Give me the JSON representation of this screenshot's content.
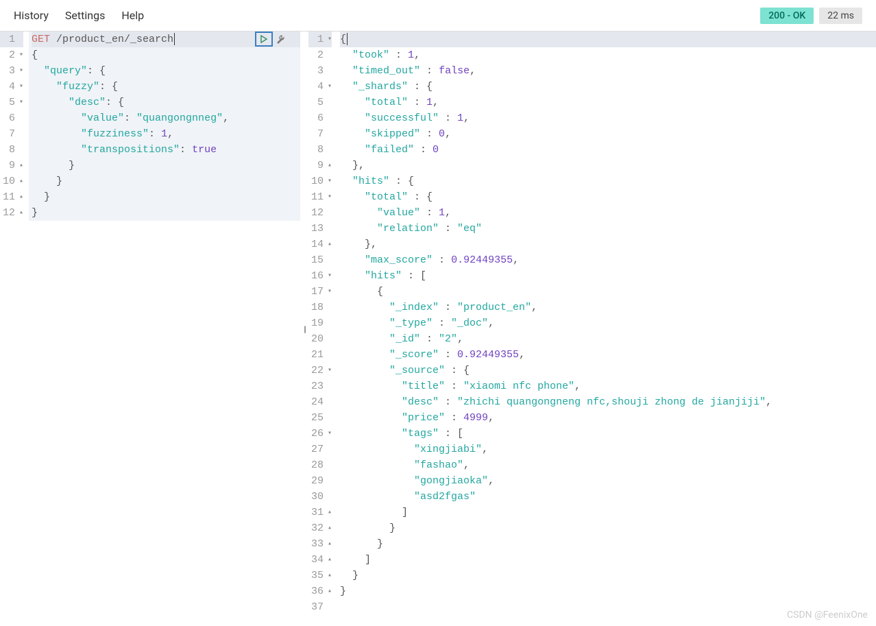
{
  "menubar": {
    "history": "History",
    "settings": "Settings",
    "help": "Help"
  },
  "status": {
    "badge": "200 - OK",
    "timing": "22 ms"
  },
  "splitter_glyph": "||",
  "watermark": "CSDN @FeenixOne",
  "request": {
    "lines": [
      {
        "n": 1,
        "fold": "",
        "tokens": [
          [
            "method",
            "GET"
          ],
          [
            "text",
            " /product_en/_search"
          ]
        ]
      },
      {
        "n": 2,
        "fold": "▾",
        "tokens": [
          [
            "punct",
            "{"
          ]
        ]
      },
      {
        "n": 3,
        "fold": "▾",
        "tokens": [
          [
            "text",
            "  "
          ],
          [
            "key",
            "\"query\""
          ],
          [
            "punct",
            ": {"
          ]
        ]
      },
      {
        "n": 4,
        "fold": "▾",
        "tokens": [
          [
            "text",
            "    "
          ],
          [
            "key",
            "\"fuzzy\""
          ],
          [
            "punct",
            ": {"
          ]
        ]
      },
      {
        "n": 5,
        "fold": "▾",
        "tokens": [
          [
            "text",
            "      "
          ],
          [
            "key",
            "\"desc\""
          ],
          [
            "punct",
            ": {"
          ]
        ]
      },
      {
        "n": 6,
        "fold": "",
        "tokens": [
          [
            "text",
            "        "
          ],
          [
            "key",
            "\"value\""
          ],
          [
            "punct",
            ": "
          ],
          [
            "str",
            "\"quangongnneg\""
          ],
          [
            "punct",
            ","
          ]
        ]
      },
      {
        "n": 7,
        "fold": "",
        "tokens": [
          [
            "text",
            "        "
          ],
          [
            "key",
            "\"fuzziness\""
          ],
          [
            "punct",
            ": "
          ],
          [
            "num",
            "1"
          ],
          [
            "punct",
            ","
          ]
        ]
      },
      {
        "n": 8,
        "fold": "",
        "tokens": [
          [
            "text",
            "        "
          ],
          [
            "key",
            "\"transpositions\""
          ],
          [
            "punct",
            ": "
          ],
          [
            "bool",
            "true"
          ]
        ]
      },
      {
        "n": 9,
        "fold": "▴",
        "tokens": [
          [
            "text",
            "      "
          ],
          [
            "punct",
            "}"
          ]
        ]
      },
      {
        "n": 10,
        "fold": "▴",
        "tokens": [
          [
            "text",
            "    "
          ],
          [
            "punct",
            "}"
          ]
        ]
      },
      {
        "n": 11,
        "fold": "▴",
        "tokens": [
          [
            "text",
            "  "
          ],
          [
            "punct",
            "}"
          ]
        ]
      },
      {
        "n": 12,
        "fold": "▴",
        "tokens": [
          [
            "punct",
            "}"
          ]
        ]
      }
    ]
  },
  "response": {
    "lines": [
      {
        "n": 1,
        "fold": "▾",
        "tokens": [
          [
            "punct",
            "{"
          ]
        ]
      },
      {
        "n": 2,
        "fold": "",
        "tokens": [
          [
            "text",
            "  "
          ],
          [
            "key",
            "\"took\""
          ],
          [
            "punct",
            " : "
          ],
          [
            "num",
            "1"
          ],
          [
            "punct",
            ","
          ]
        ]
      },
      {
        "n": 3,
        "fold": "",
        "tokens": [
          [
            "text",
            "  "
          ],
          [
            "key",
            "\"timed_out\""
          ],
          [
            "punct",
            " : "
          ],
          [
            "bool",
            "false"
          ],
          [
            "punct",
            ","
          ]
        ]
      },
      {
        "n": 4,
        "fold": "▾",
        "tokens": [
          [
            "text",
            "  "
          ],
          [
            "key",
            "\"_shards\""
          ],
          [
            "punct",
            " : {"
          ]
        ]
      },
      {
        "n": 5,
        "fold": "",
        "tokens": [
          [
            "text",
            "    "
          ],
          [
            "key",
            "\"total\""
          ],
          [
            "punct",
            " : "
          ],
          [
            "num",
            "1"
          ],
          [
            "punct",
            ","
          ]
        ]
      },
      {
        "n": 6,
        "fold": "",
        "tokens": [
          [
            "text",
            "    "
          ],
          [
            "key",
            "\"successful\""
          ],
          [
            "punct",
            " : "
          ],
          [
            "num",
            "1"
          ],
          [
            "punct",
            ","
          ]
        ]
      },
      {
        "n": 7,
        "fold": "",
        "tokens": [
          [
            "text",
            "    "
          ],
          [
            "key",
            "\"skipped\""
          ],
          [
            "punct",
            " : "
          ],
          [
            "num",
            "0"
          ],
          [
            "punct",
            ","
          ]
        ]
      },
      {
        "n": 8,
        "fold": "",
        "tokens": [
          [
            "text",
            "    "
          ],
          [
            "key",
            "\"failed\""
          ],
          [
            "punct",
            " : "
          ],
          [
            "num",
            "0"
          ]
        ]
      },
      {
        "n": 9,
        "fold": "▴",
        "tokens": [
          [
            "text",
            "  "
          ],
          [
            "punct",
            "},"
          ]
        ]
      },
      {
        "n": 10,
        "fold": "▾",
        "tokens": [
          [
            "text",
            "  "
          ],
          [
            "key",
            "\"hits\""
          ],
          [
            "punct",
            " : {"
          ]
        ]
      },
      {
        "n": 11,
        "fold": "▾",
        "tokens": [
          [
            "text",
            "    "
          ],
          [
            "key",
            "\"total\""
          ],
          [
            "punct",
            " : {"
          ]
        ]
      },
      {
        "n": 12,
        "fold": "",
        "tokens": [
          [
            "text",
            "      "
          ],
          [
            "key",
            "\"value\""
          ],
          [
            "punct",
            " : "
          ],
          [
            "num",
            "1"
          ],
          [
            "punct",
            ","
          ]
        ]
      },
      {
        "n": 13,
        "fold": "",
        "tokens": [
          [
            "text",
            "      "
          ],
          [
            "key",
            "\"relation\""
          ],
          [
            "punct",
            " : "
          ],
          [
            "str",
            "\"eq\""
          ]
        ]
      },
      {
        "n": 14,
        "fold": "▴",
        "tokens": [
          [
            "text",
            "    "
          ],
          [
            "punct",
            "},"
          ]
        ]
      },
      {
        "n": 15,
        "fold": "",
        "tokens": [
          [
            "text",
            "    "
          ],
          [
            "key",
            "\"max_score\""
          ],
          [
            "punct",
            " : "
          ],
          [
            "num",
            "0.92449355"
          ],
          [
            "punct",
            ","
          ]
        ]
      },
      {
        "n": 16,
        "fold": "▾",
        "tokens": [
          [
            "text",
            "    "
          ],
          [
            "key",
            "\"hits\""
          ],
          [
            "punct",
            " : ["
          ]
        ]
      },
      {
        "n": 17,
        "fold": "▾",
        "tokens": [
          [
            "text",
            "      "
          ],
          [
            "punct",
            "{"
          ]
        ]
      },
      {
        "n": 18,
        "fold": "",
        "tokens": [
          [
            "text",
            "        "
          ],
          [
            "key",
            "\"_index\""
          ],
          [
            "punct",
            " : "
          ],
          [
            "str",
            "\"product_en\""
          ],
          [
            "punct",
            ","
          ]
        ]
      },
      {
        "n": 19,
        "fold": "",
        "tokens": [
          [
            "text",
            "        "
          ],
          [
            "key",
            "\"_type\""
          ],
          [
            "punct",
            " : "
          ],
          [
            "str",
            "\"_doc\""
          ],
          [
            "punct",
            ","
          ]
        ]
      },
      {
        "n": 20,
        "fold": "",
        "tokens": [
          [
            "text",
            "        "
          ],
          [
            "key",
            "\"_id\""
          ],
          [
            "punct",
            " : "
          ],
          [
            "str",
            "\"2\""
          ],
          [
            "punct",
            ","
          ]
        ]
      },
      {
        "n": 21,
        "fold": "",
        "tokens": [
          [
            "text",
            "        "
          ],
          [
            "key",
            "\"_score\""
          ],
          [
            "punct",
            " : "
          ],
          [
            "num",
            "0.92449355"
          ],
          [
            "punct",
            ","
          ]
        ]
      },
      {
        "n": 22,
        "fold": "▾",
        "tokens": [
          [
            "text",
            "        "
          ],
          [
            "key",
            "\"_source\""
          ],
          [
            "punct",
            " : {"
          ]
        ]
      },
      {
        "n": 23,
        "fold": "",
        "tokens": [
          [
            "text",
            "          "
          ],
          [
            "key",
            "\"title\""
          ],
          [
            "punct",
            " : "
          ],
          [
            "str",
            "\"xiaomi nfc phone\""
          ],
          [
            "punct",
            ","
          ]
        ]
      },
      {
        "n": 24,
        "fold": "",
        "tokens": [
          [
            "text",
            "          "
          ],
          [
            "key",
            "\"desc\""
          ],
          [
            "punct",
            " : "
          ],
          [
            "str",
            "\"zhichi quangongneng nfc,shouji zhong de jianjiji\""
          ],
          [
            "punct",
            ","
          ]
        ]
      },
      {
        "n": 25,
        "fold": "",
        "tokens": [
          [
            "text",
            "          "
          ],
          [
            "key",
            "\"price\""
          ],
          [
            "punct",
            " : "
          ],
          [
            "num",
            "4999"
          ],
          [
            "punct",
            ","
          ]
        ]
      },
      {
        "n": 26,
        "fold": "▾",
        "tokens": [
          [
            "text",
            "          "
          ],
          [
            "key",
            "\"tags\""
          ],
          [
            "punct",
            " : ["
          ]
        ]
      },
      {
        "n": 27,
        "fold": "",
        "tokens": [
          [
            "text",
            "            "
          ],
          [
            "str",
            "\"xingjiabi\""
          ],
          [
            "punct",
            ","
          ]
        ]
      },
      {
        "n": 28,
        "fold": "",
        "tokens": [
          [
            "text",
            "            "
          ],
          [
            "str",
            "\"fashao\""
          ],
          [
            "punct",
            ","
          ]
        ]
      },
      {
        "n": 29,
        "fold": "",
        "tokens": [
          [
            "text",
            "            "
          ],
          [
            "str",
            "\"gongjiaoka\""
          ],
          [
            "punct",
            ","
          ]
        ]
      },
      {
        "n": 30,
        "fold": "",
        "tokens": [
          [
            "text",
            "            "
          ],
          [
            "str",
            "\"asd2fgas\""
          ]
        ]
      },
      {
        "n": 31,
        "fold": "▴",
        "tokens": [
          [
            "text",
            "          "
          ],
          [
            "punct",
            "]"
          ]
        ]
      },
      {
        "n": 32,
        "fold": "▴",
        "tokens": [
          [
            "text",
            "        "
          ],
          [
            "punct",
            "}"
          ]
        ]
      },
      {
        "n": 33,
        "fold": "▴",
        "tokens": [
          [
            "text",
            "      "
          ],
          [
            "punct",
            "}"
          ]
        ]
      },
      {
        "n": 34,
        "fold": "▴",
        "tokens": [
          [
            "text",
            "    "
          ],
          [
            "punct",
            "]"
          ]
        ]
      },
      {
        "n": 35,
        "fold": "▴",
        "tokens": [
          [
            "text",
            "  "
          ],
          [
            "punct",
            "}"
          ]
        ]
      },
      {
        "n": 36,
        "fold": "▴",
        "tokens": [
          [
            "punct",
            "}"
          ]
        ]
      },
      {
        "n": 37,
        "fold": "",
        "tokens": []
      }
    ]
  }
}
